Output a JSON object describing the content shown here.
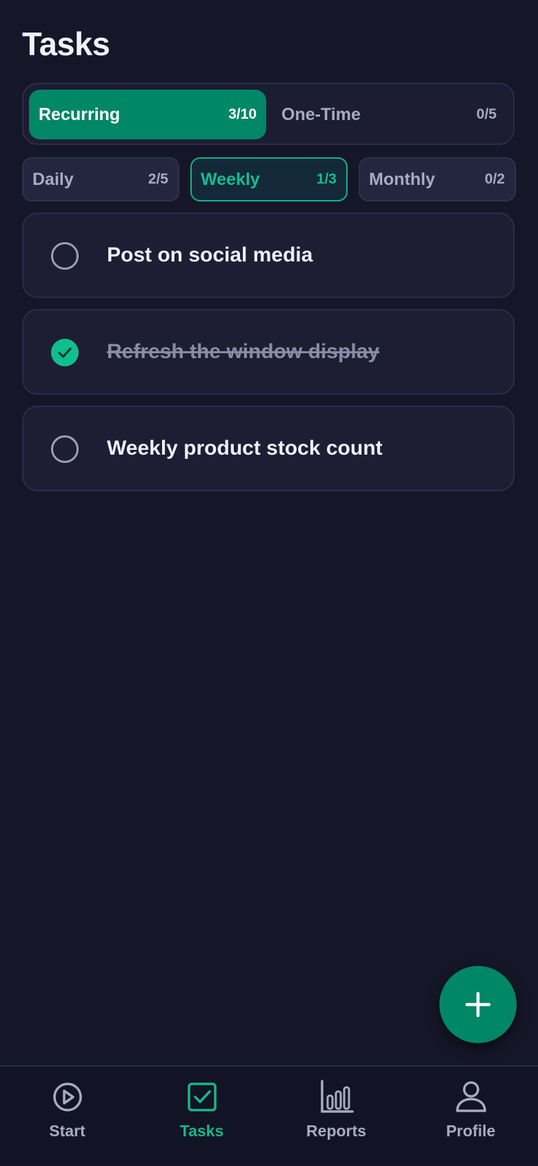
{
  "header": {
    "title": "Tasks"
  },
  "segments": [
    {
      "label": "Recurring",
      "count": "3/10"
    },
    {
      "label": "One-Time",
      "count": "0/5"
    }
  ],
  "subtabs": [
    {
      "label": "Daily",
      "count": "2/5"
    },
    {
      "label": "Weekly",
      "count": "1/3"
    },
    {
      "label": "Monthly",
      "count": "0/2"
    }
  ],
  "tasks": [
    {
      "text": "Post on social media",
      "done": false
    },
    {
      "text": "Refresh the window display",
      "done": true
    },
    {
      "text": "Weekly product stock count",
      "done": false
    }
  ],
  "fab": {
    "icon": "plus-icon"
  },
  "nav": [
    {
      "label": "Start",
      "icon": "play-circle-icon"
    },
    {
      "label": "Tasks",
      "icon": "checkbox-icon"
    },
    {
      "label": "Reports",
      "icon": "bar-chart-icon"
    },
    {
      "label": "Profile",
      "icon": "user-icon"
    }
  ],
  "colors": {
    "background": "#151628",
    "accent": "#008765",
    "accent_bright": "#14BE90",
    "card": "#1D1E34"
  }
}
